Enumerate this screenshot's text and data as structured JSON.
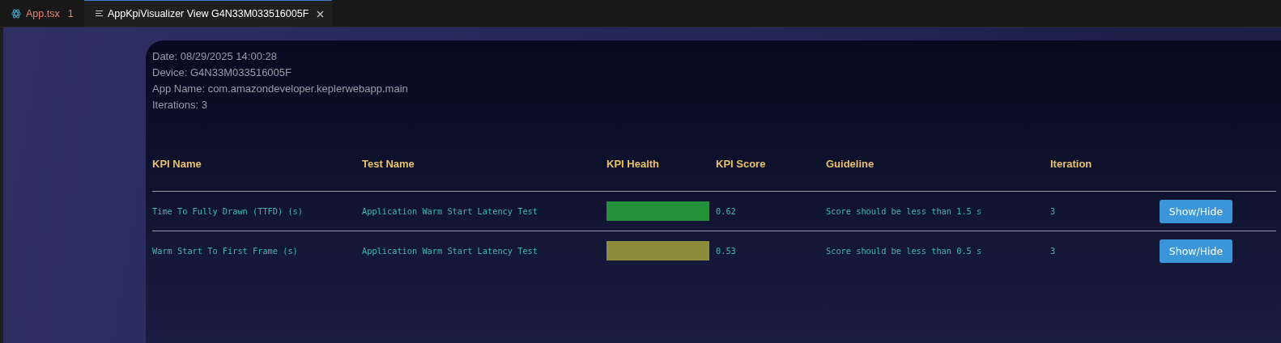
{
  "tabs": [
    {
      "label": "App.tsx",
      "badge": "1",
      "kind": "file",
      "selected": false
    },
    {
      "label": "AppKpiVisualizer View G4N33M033516005F",
      "kind": "preview",
      "selected": true
    }
  ],
  "info": [
    "Date: 08/29/2025 14:00:28",
    "Device: G4N33M033516005F",
    "App Name: com.amazondeveloper.keplerwebapp.main",
    "Iterations: 3"
  ],
  "table": {
    "columns": [
      "KPI Name",
      "Test Name",
      "KPI Health",
      "KPI Score",
      "Guideline",
      "Iteration"
    ],
    "rows": [
      {
        "kpi_name": "Time To Fully Drawn (TTFD) (s)",
        "test_name": "Application Warm Start Latency Test",
        "color": "#23913a",
        "score": "0.62",
        "guideline": "Score should be less than 1.5 s",
        "iteration": "3",
        "button": "Show/Hide"
      },
      {
        "kpi_name": "Warm Start To First Frame (s)",
        "test_name": "Application Warm Start Latency Test",
        "color": "#8e8d3b",
        "score": "0.53",
        "guideline": "Score should be less than 0.5 s",
        "iteration": "3",
        "button": "Show/Hide"
      }
    ]
  }
}
